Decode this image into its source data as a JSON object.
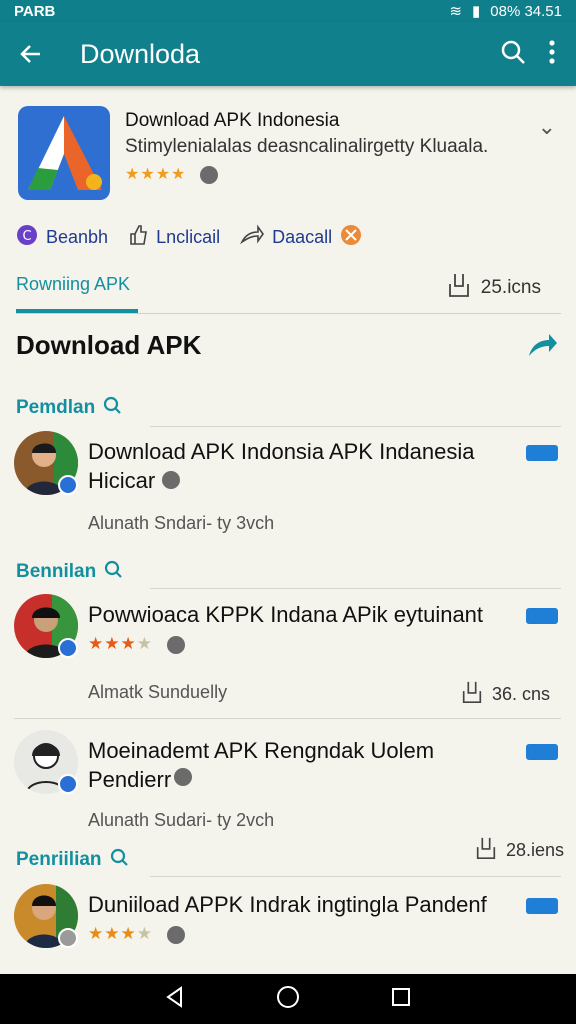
{
  "status": {
    "left": "PARB",
    "right": "08% 34.51"
  },
  "appbar": {
    "title": "Downloda"
  },
  "app": {
    "name": "Download APK Indonesia",
    "subtitle": "Stimylenialalas deasncalinalirgetty Kluaala.",
    "stars": "★★★★"
  },
  "actions": [
    {
      "label": "Beanbh"
    },
    {
      "label": "Lnclicail"
    },
    {
      "label": "Daacall"
    }
  ],
  "tabs": {
    "active": "Rowniing APK",
    "count": "25.icns"
  },
  "section": {
    "title": "Download APK"
  },
  "groups": [
    {
      "label": "Pemdlan"
    },
    {
      "label": "Bennilan"
    },
    {
      "label": "Penriilian"
    }
  ],
  "items": [
    {
      "title": "Download APK Indonsia APK Indanesia Hicicar",
      "meta": "Alunath Sndari- ty 3vch",
      "stars_full": "",
      "stars_dim": "",
      "count": ""
    },
    {
      "title": "Powwioaca KPPK Indana APik eytuinant",
      "meta": "Almatk Sunduelly",
      "stars_full": "★★★",
      "stars_dim": "★",
      "count": "36. cns"
    },
    {
      "title": "Moeinademt APK Rengndak Uolem Pendierr",
      "meta": "Alunath Sudari- ty 2vch",
      "stars_full": "",
      "stars_dim": "",
      "count": "28.iens"
    },
    {
      "title": "Duniiload APPK Indrak ingtingla Pandenf",
      "meta": "",
      "stars_full": "★★★",
      "stars_dim": "★",
      "count": ""
    }
  ],
  "icons": {
    "back": "back-arrow-icon",
    "search": "search-icon",
    "more": "more-vert-icon",
    "share": "share-icon",
    "download": "download-icon"
  },
  "colors": {
    "accent": "#10808c",
    "link": "#1390a0",
    "star": "#f29b1d",
    "chip": "#1f7fd6"
  }
}
